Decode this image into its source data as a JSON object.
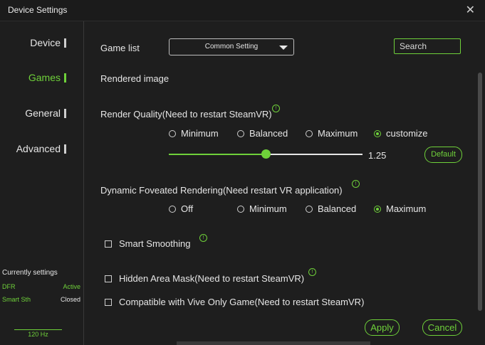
{
  "window": {
    "title": "Device Settings"
  },
  "sidebar": {
    "items": [
      {
        "label": "Device",
        "active": false
      },
      {
        "label": "Games",
        "active": true
      },
      {
        "label": "General",
        "active": false
      },
      {
        "label": "Advanced",
        "active": false
      }
    ]
  },
  "current_settings": {
    "header": "Currently settings",
    "rows": [
      {
        "key": "DFR",
        "value": "Active"
      },
      {
        "key": "Smart Sth",
        "value": "Closed"
      }
    ],
    "refresh": "120 Hz"
  },
  "game_list": {
    "label": "Game list",
    "selected": "Common Setting",
    "search_placeholder": "Search"
  },
  "rendered_image": {
    "label": "Rendered image"
  },
  "render_quality": {
    "label": "Render Quality(Need to restart SteamVR)",
    "options": [
      "Minimum",
      "Balanced",
      "Maximum",
      "customize"
    ],
    "selected": "customize",
    "slider_fraction": 0.5,
    "value": "1.25",
    "default_label": "Default"
  },
  "dfr": {
    "label": "Dynamic Foveated Rendering(Need restart VR application)",
    "options": [
      "Off",
      "Minimum",
      "Balanced",
      "Maximum"
    ],
    "selected": "Maximum"
  },
  "checks": {
    "smart_smoothing": "Smart Smoothing",
    "hidden_area": "Hidden Area Mask(Need to restart SteamVR)",
    "vive_only": "Compatible with Vive Only Game(Need to restart SteamVR)"
  },
  "buttons": {
    "apply": "Apply",
    "cancel": "Cancel"
  },
  "info_glyph": "!",
  "close_glyph": "✕",
  "colors": {
    "accent": "#6fd13a",
    "background": "#1e1e1e"
  }
}
